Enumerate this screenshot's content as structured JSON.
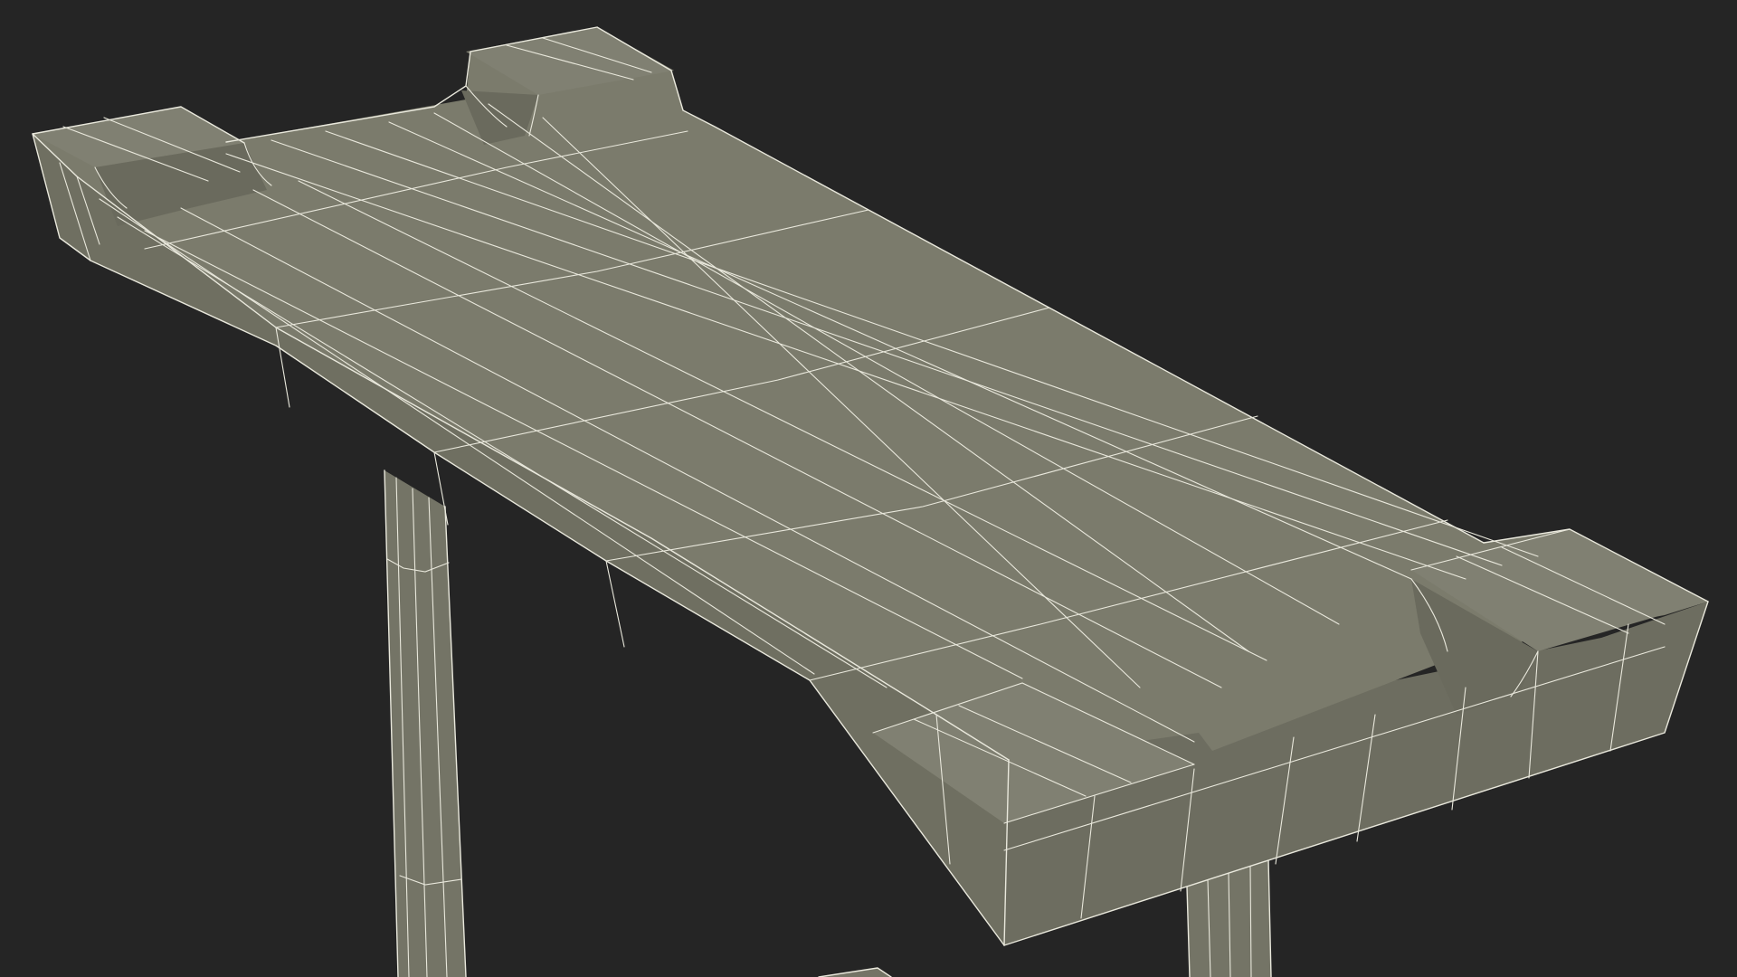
{
  "scene": {
    "subject": "wireframe-bench",
    "background_color": "#252525",
    "surface_color_top": "#7b7b6c",
    "surface_color_side": "#6f6f61",
    "surface_color_dark": "#66665a",
    "leg_color": "#747466",
    "wire_color": "#e9e8dc"
  }
}
